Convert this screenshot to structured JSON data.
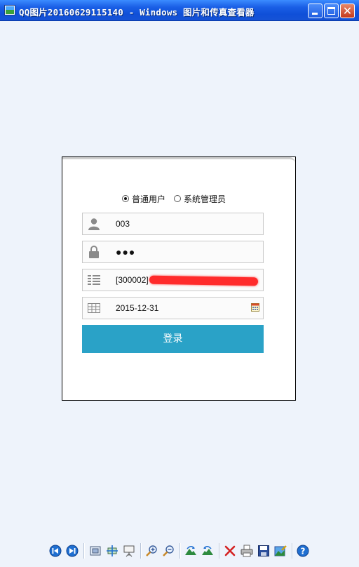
{
  "window": {
    "title": "QQ图片20160629115140 - Windows 图片和传真查看器",
    "buttons": {
      "minimize": "minimize",
      "maximize": "maximize",
      "close": "✕"
    }
  },
  "login": {
    "role_options": [
      {
        "label": "普通用户",
        "selected": true
      },
      {
        "label": "系统管理员",
        "selected": false
      }
    ],
    "username_value": "003",
    "password_value": "●●●",
    "account_value": "[300002]",
    "date_value": "2015-12-31",
    "submit_label": "登录"
  },
  "colors": {
    "titlebar": "#1a5fe6",
    "login_button": "#2aa2c7",
    "viewer_background": "#eef3fb",
    "redaction": "#ff2b2b"
  },
  "toolbar": {
    "icons": [
      "previous-image-icon",
      "next-image-icon",
      "best-fit-icon",
      "actual-size-icon",
      "slideshow-icon",
      "zoom-in-icon",
      "zoom-out-icon",
      "rotate-clockwise-icon",
      "rotate-counterclockwise-icon",
      "delete-icon",
      "print-icon",
      "save-icon",
      "edit-image-icon",
      "help-icon"
    ]
  }
}
